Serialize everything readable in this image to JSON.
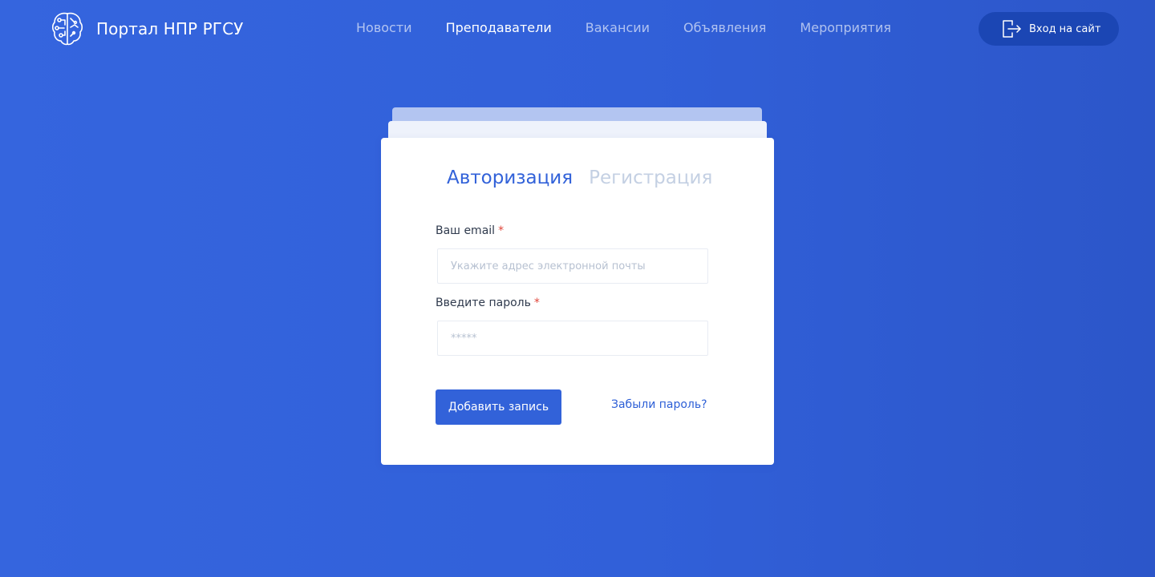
{
  "header": {
    "brand_title": "Портал НПР РГСУ",
    "brand_icon": "brain-circuit-icon",
    "nav": [
      {
        "label": "Новости",
        "active": false
      },
      {
        "label": "Преподаватели",
        "active": true
      },
      {
        "label": "Вакансии",
        "active": false
      },
      {
        "label": "Объявления",
        "active": false
      },
      {
        "label": "Мероприятия",
        "active": false
      }
    ],
    "login_button": {
      "label": "Вход на сайт",
      "icon": "sign-in-icon"
    }
  },
  "auth_card": {
    "tabs": [
      {
        "label": "Авторизация",
        "active": true
      },
      {
        "label": "Регистрация",
        "active": false
      }
    ],
    "email": {
      "label": "Ваш email",
      "required_mark": "*",
      "placeholder": "Укажите адрес электронной почты",
      "value": ""
    },
    "password": {
      "label": "Введите пароль",
      "required_mark": "*",
      "placeholder": "*****",
      "value": ""
    },
    "submit_label": "Добавить запись",
    "forgot_label": "Забыли пароль?"
  },
  "colors": {
    "background": "#3262d9",
    "accent": "#3262d9",
    "login_button_bg": "#1b46b4",
    "required": "#e0453a",
    "tab_inactive": "#c4d0e3"
  }
}
